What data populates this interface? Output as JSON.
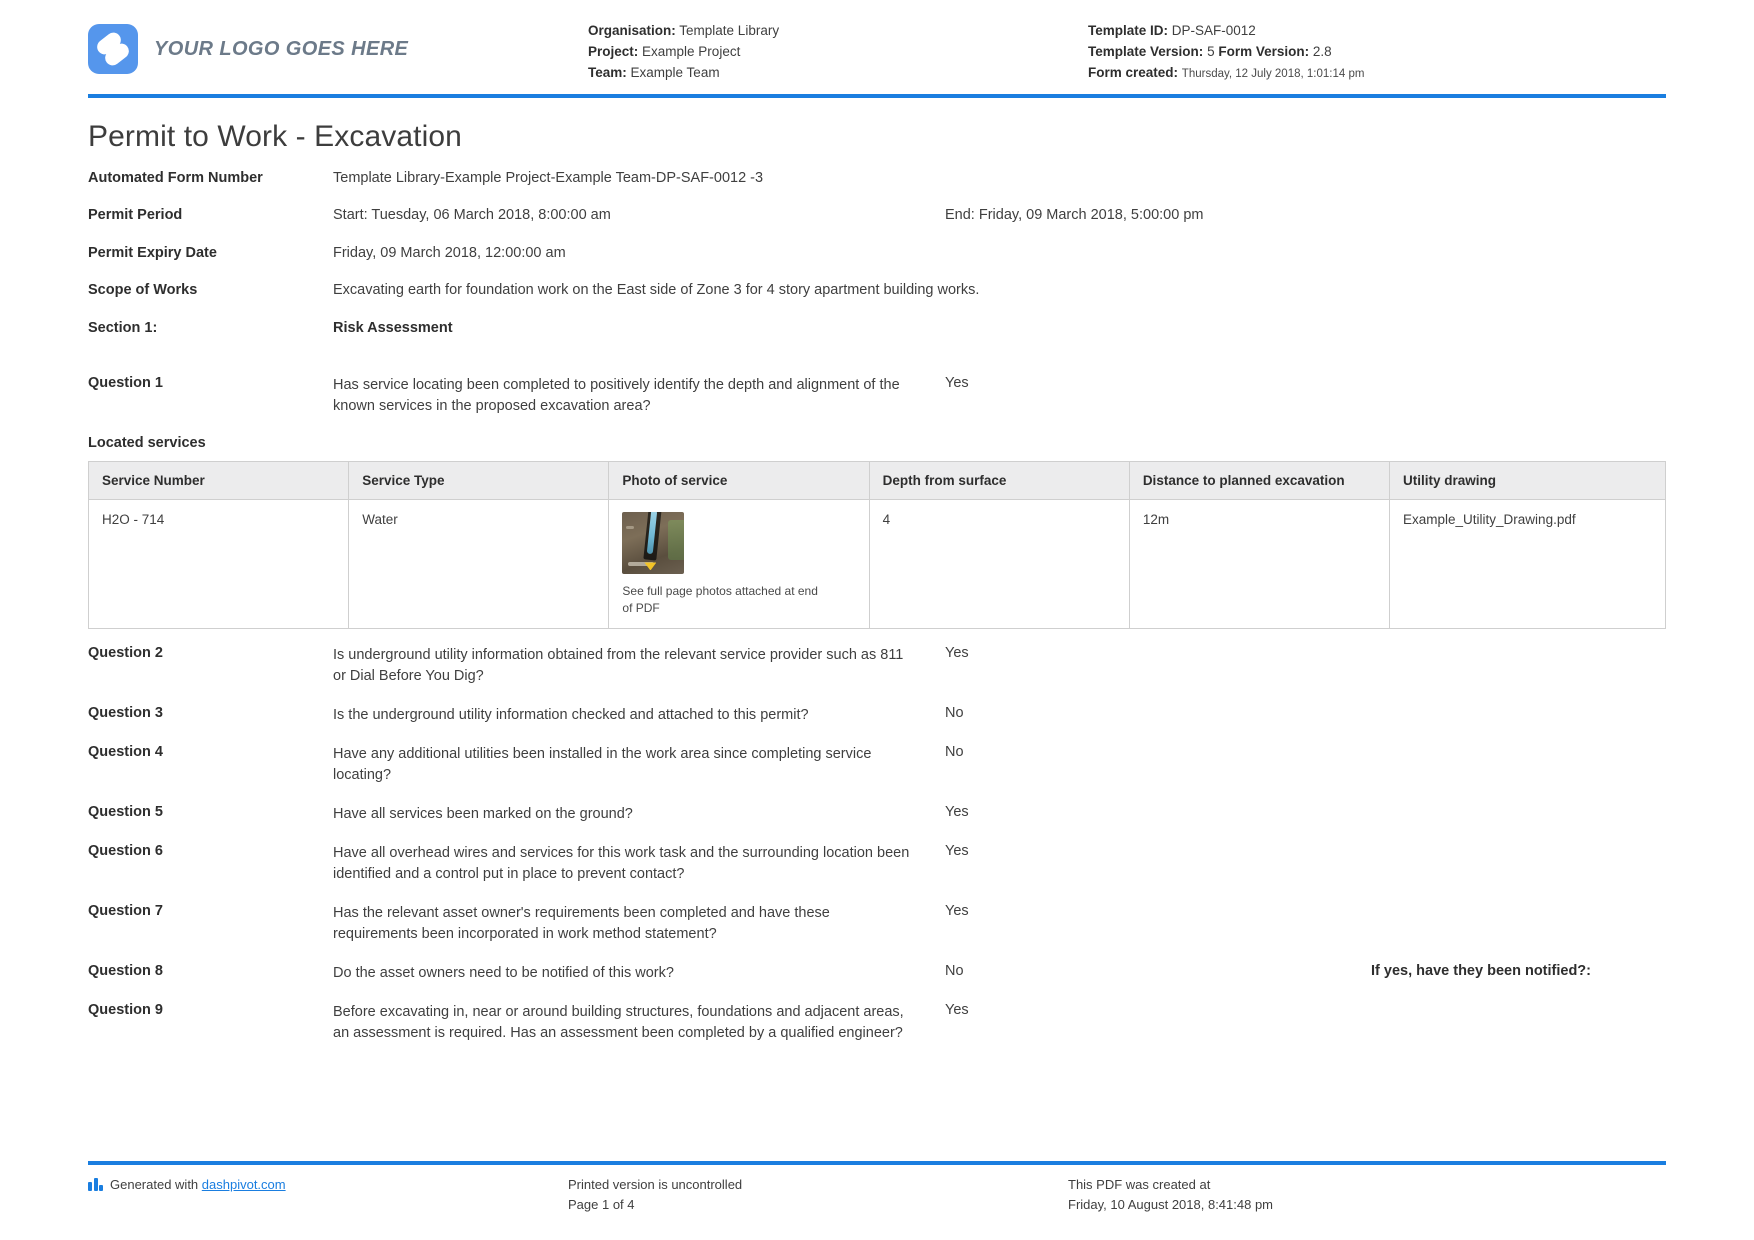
{
  "header": {
    "logo_text": "YOUR LOGO GOES HERE",
    "org_label": "Organisation:",
    "org_value": "Template Library",
    "project_label": "Project:",
    "project_value": "Example Project",
    "team_label": "Team:",
    "team_value": "Example Team",
    "template_id_label": "Template ID:",
    "template_id_value": "DP-SAF-0012",
    "template_version_label": "Template Version:",
    "template_version_value": "5",
    "form_version_label": "Form Version:",
    "form_version_value": "2.8",
    "form_created_label": "Form created:",
    "form_created_value": "Thursday, 12 July 2018, 1:01:14 pm"
  },
  "title": "Permit to Work - Excavation",
  "fields": {
    "form_number_label": "Automated Form Number",
    "form_number_value": "Template Library-Example Project-Example Team-DP-SAF-0012   -3",
    "permit_period_label": "Permit Period",
    "permit_period_start": "Start: Tuesday, 06 March 2018, 8:00:00 am",
    "permit_period_end": "End: Friday, 09 March 2018, 5:00:00 pm",
    "permit_expiry_label": "Permit Expiry Date",
    "permit_expiry_value": "Friday, 09 March 2018, 12:00:00 am",
    "scope_label": "Scope of Works",
    "scope_value": "Excavating earth for foundation work on the East side of Zone 3 for 4 story apartment building works.",
    "section_label": "Section 1:",
    "section_value": "Risk Assessment"
  },
  "question1": {
    "label": "Question 1",
    "text": "Has service locating been completed to positively identify the depth and alignment of the known services in the proposed excavation area?",
    "answer": "Yes"
  },
  "located_services": {
    "title": "Located services",
    "columns": [
      "Service Number",
      "Service Type",
      "Photo of service",
      "Depth from surface",
      "Distance to planned excavation",
      "Utility drawing"
    ],
    "rows": [
      {
        "service_number": "H2O - 714",
        "service_type": "Water",
        "photo_caption": "See full page photos attached at end of PDF",
        "depth": "4",
        "distance": "12m",
        "drawing": "Example_Utility_Drawing.pdf"
      }
    ]
  },
  "questions": [
    {
      "label": "Question 2",
      "text": "Is underground utility information obtained from the relevant service provider such as 811 or Dial Before You Dig?",
      "answer": "Yes",
      "extra": ""
    },
    {
      "label": "Question 3",
      "text": "Is the underground utility information checked and attached to this permit?",
      "answer": "No",
      "extra": ""
    },
    {
      "label": "Question 4",
      "text": "Have any additional utilities been installed in the work area since completing service locating?",
      "answer": "No",
      "extra": ""
    },
    {
      "label": "Question 5",
      "text": "Have all services been marked on the ground?",
      "answer": "Yes",
      "extra": ""
    },
    {
      "label": "Question 6",
      "text": "Have all overhead wires and services for this work task and the surrounding location been identified and a control put in place to prevent contact?",
      "answer": "Yes",
      "extra": ""
    },
    {
      "label": "Question 7",
      "text": "Has the relevant asset owner's requirements been completed and have these requirements been incorporated in work method statement?",
      "answer": "Yes",
      "extra": ""
    },
    {
      "label": "Question 8",
      "text": "Do the asset owners need to be notified of this work?",
      "answer": "No",
      "extra": "If yes, have they been notified?:"
    },
    {
      "label": "Question 9",
      "text": "Before excavating in, near or around building structures, foundations and adjacent areas, an assessment is required. Has an assessment been completed by a qualified engineer?",
      "answer": "Yes",
      "extra": ""
    }
  ],
  "footer": {
    "generated_prefix": "Generated with ",
    "generated_link": "dashpivot.com",
    "uncontrolled": "Printed version is uncontrolled",
    "page": "Page 1 of 4",
    "created_label": "This PDF was created at",
    "created_value": "Friday, 10 August 2018, 8:41:48 pm"
  },
  "colors": {
    "accent": "#1a7ee0",
    "logo": "#5596ec",
    "table_header_bg": "#ececed"
  }
}
